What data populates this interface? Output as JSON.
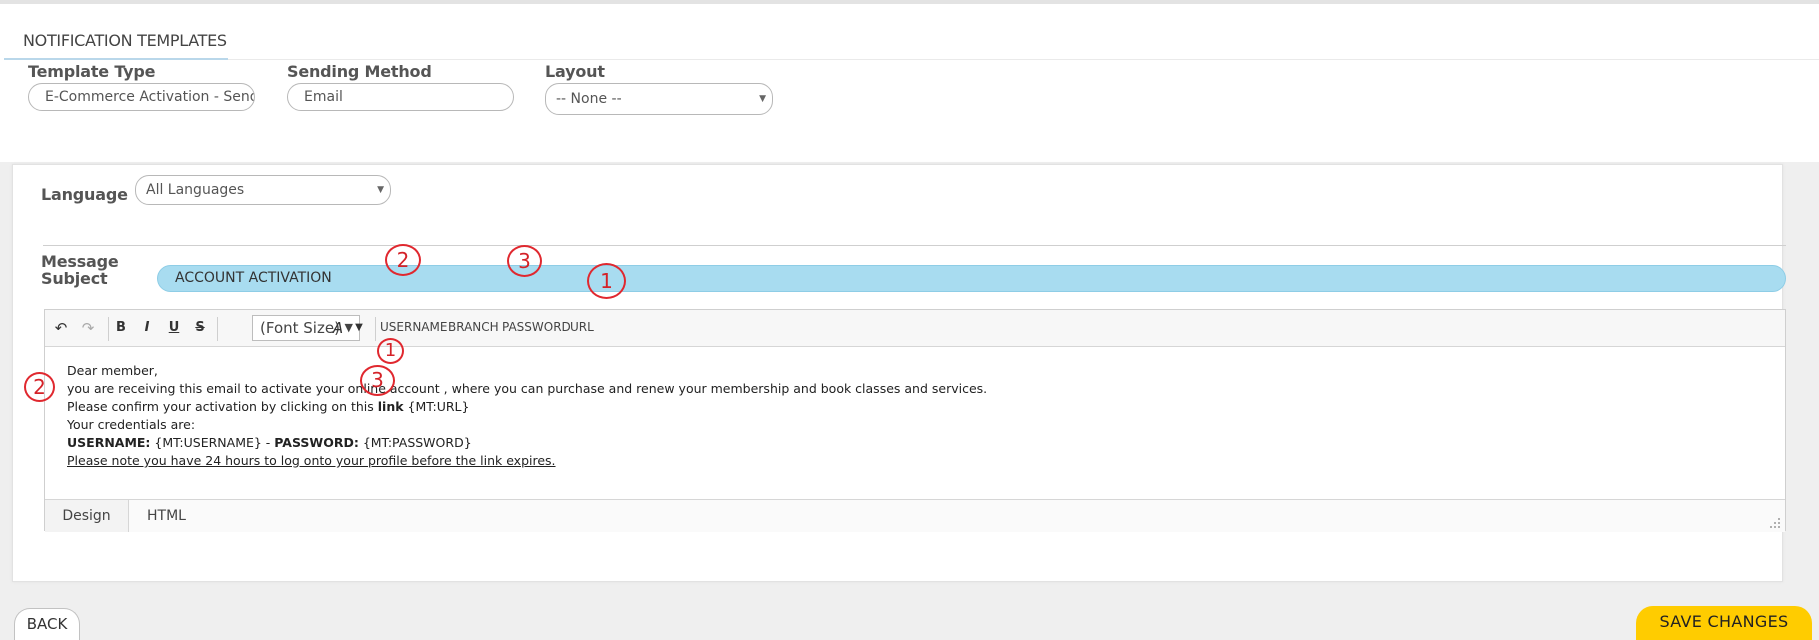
{
  "page": {
    "tab_title": "NOTIFICATION TEMPLATES"
  },
  "template_type": {
    "label": "Template Type",
    "value": "E-Commerce Activation - Send Cr"
  },
  "sending_method": {
    "label": "Sending Method",
    "value": "Email"
  },
  "layout": {
    "label": "Layout",
    "value": "-- None --"
  },
  "language": {
    "label": "Language",
    "value": "All Languages"
  },
  "message_subject": {
    "label": "Message Subject",
    "value": "ACCOUNT ACTIVATION"
  },
  "editor": {
    "toolbar": {
      "undo_icon": "↶",
      "redo_icon": "↷",
      "bold": "B",
      "italic": "I",
      "underline": "U",
      "strike": "S",
      "font_size": "(Font Size)",
      "text_color_icon": "A",
      "fields": [
        "USERNAME",
        "BRANCH",
        "PASSWORD",
        "URL"
      ]
    },
    "content": {
      "greeting": "Dear member,",
      "line1": "you are receiving this email to activate your online account , where you can purchase and renew your membership and book classes and services.",
      "line2_prefix": "Please confirm your activation by clicking on this ",
      "line2_bold": "link",
      "line2_token": " {MT:URL}",
      "line3": "Your credentials are:",
      "username_label": "USERNAME:",
      "username_token": " {MT:USERNAME} - ",
      "password_label": "PASSWORD:",
      "password_token": " {MT:PASSWORD}",
      "note": "Please note you have 24 hours to log onto your profile before the link expires."
    },
    "modes": {
      "design": "Design",
      "html": "HTML"
    }
  },
  "annotations": {
    "field_url": "1",
    "field_username": "2",
    "field_password": "3",
    "content_url": "1",
    "content_username": "2",
    "content_password": "3"
  },
  "actions": {
    "back": "BACK",
    "save": "SAVE CHANGES"
  },
  "colors": {
    "accent_yellow": "#ffcc00",
    "subject_blue": "#a8dcf0",
    "annotation_red": "#e0282f"
  }
}
